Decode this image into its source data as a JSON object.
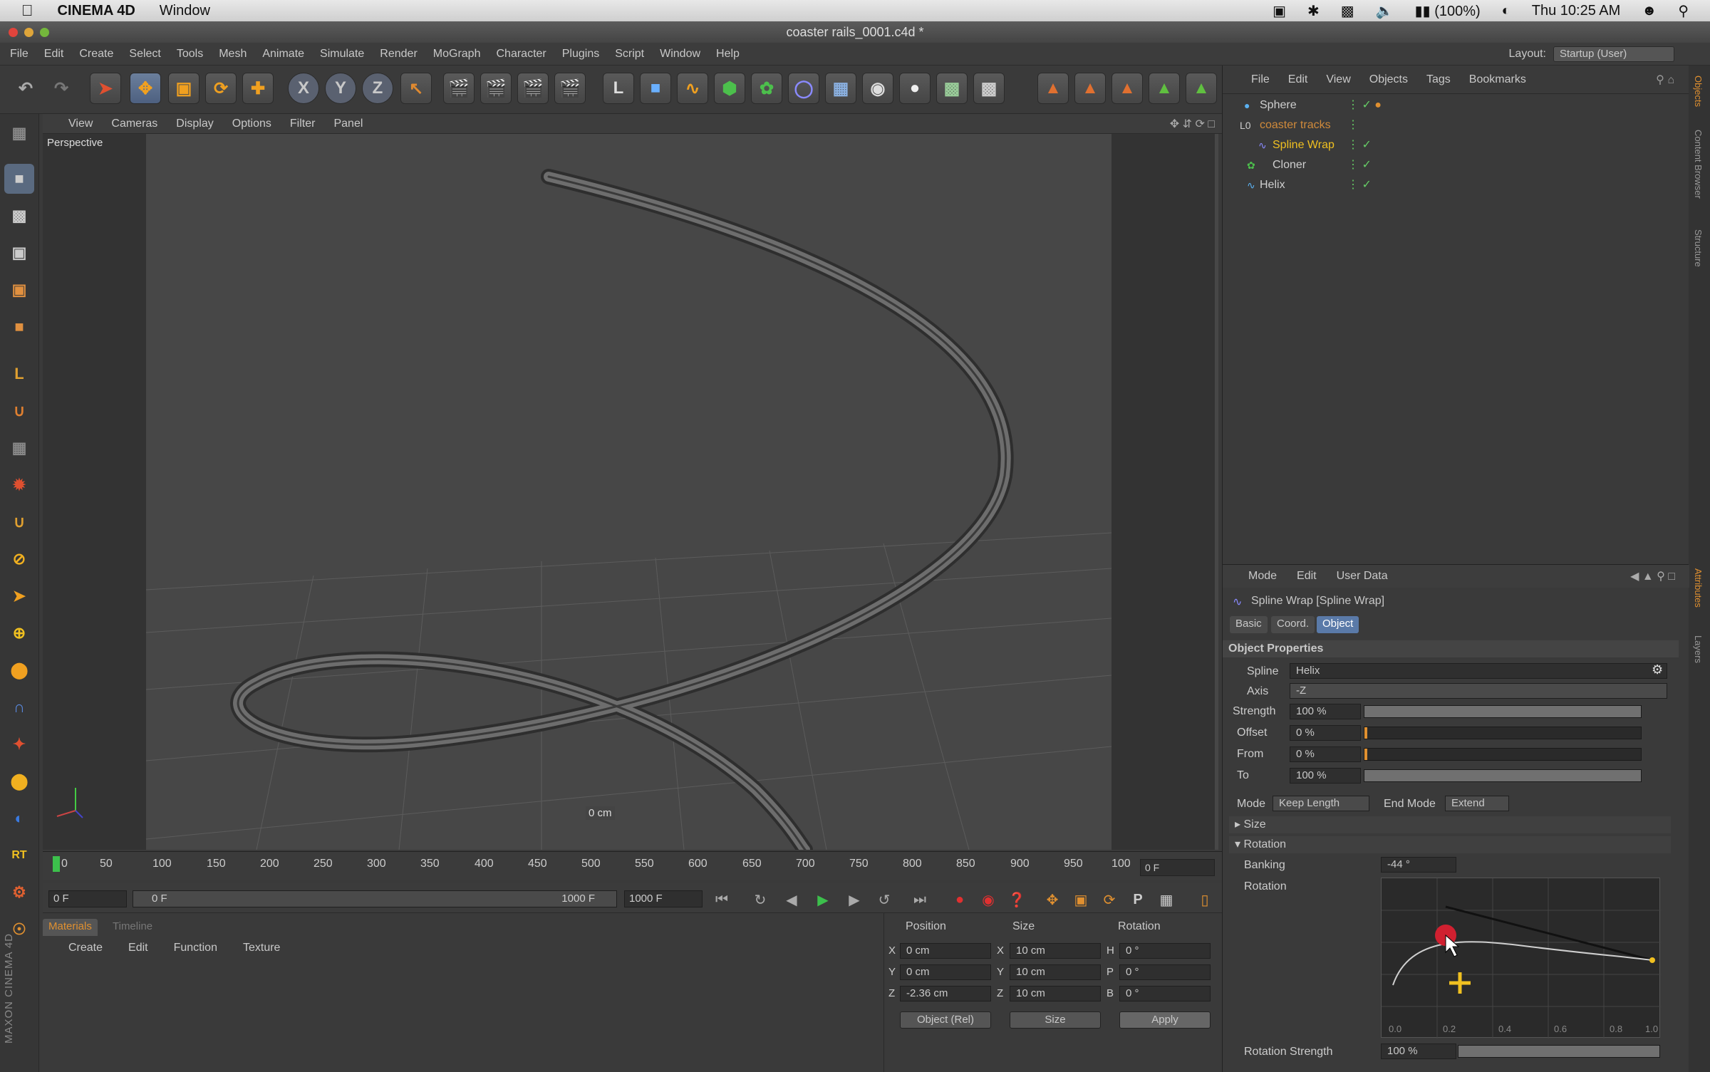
{
  "macbar": {
    "app": "CINEMA 4D",
    "menu": "Window",
    "battery": "(100%)",
    "clock": "Thu 10:25 AM"
  },
  "window": {
    "title": "coaster rails_0001.c4d *"
  },
  "menu": {
    "items": [
      "File",
      "Edit",
      "Create",
      "Select",
      "Tools",
      "Mesh",
      "Animate",
      "Simulate",
      "Render",
      "MoGraph",
      "Character",
      "Plugins",
      "Script",
      "Window",
      "Help"
    ],
    "layout_label": "Layout:",
    "layout_value": "Startup (User)"
  },
  "toolbar": {
    "axis_x": "X",
    "axis_y": "Y",
    "axis_z": "Z"
  },
  "viewport": {
    "menu": [
      "View",
      "Cameras",
      "Display",
      "Options",
      "Filter",
      "Panel"
    ],
    "label": "Perspective",
    "scale": "0 cm"
  },
  "timeline": {
    "ticks": [
      "0",
      "50",
      "100",
      "150",
      "200",
      "250",
      "300",
      "350",
      "400",
      "450",
      "500",
      "550",
      "600",
      "650",
      "700",
      "750",
      "800",
      "850",
      "900",
      "950",
      "100"
    ],
    "current_frame": "0 F",
    "start": "0 F",
    "range_start": "0 F",
    "range_end": "1000 F",
    "end": "1000 F"
  },
  "materials": {
    "tab_materials": "Materials",
    "tab_timeline": "Timeline",
    "menu": [
      "Create",
      "Edit",
      "Function",
      "Texture"
    ]
  },
  "coords": {
    "position": "Position",
    "size": "Size",
    "rotation": "Rotation",
    "rows": [
      {
        "axis": "X",
        "pos": "0 cm",
        "size_axis": "X",
        "size": "10 cm",
        "rot_axis": "H",
        "rot": "0 °"
      },
      {
        "axis": "Y",
        "pos": "0 cm",
        "size_axis": "Y",
        "size": "10 cm",
        "rot_axis": "P",
        "rot": "0 °"
      },
      {
        "axis": "Z",
        "pos": "-2.36 cm",
        "size_axis": "Z",
        "size": "10 cm",
        "rot_axis": "B",
        "rot": "0 °"
      }
    ],
    "mode": "Object (Rel)",
    "size_mode": "Size",
    "apply": "Apply"
  },
  "objects": {
    "menu": [
      "File",
      "Edit",
      "View",
      "Objects",
      "Tags",
      "Bookmarks"
    ],
    "items": [
      {
        "name": "Sphere",
        "color": "#cfcfcf"
      },
      {
        "name": "coaster tracks",
        "color": "#d08a3a"
      },
      {
        "name": "Spline Wrap",
        "color": "#f0c020"
      },
      {
        "name": "Cloner",
        "color": "#cfcfcf"
      },
      {
        "name": "Helix",
        "color": "#cfcfcf"
      }
    ]
  },
  "right_tabs": [
    "Objects",
    "Content Browser",
    "Structure",
    "Attributes",
    "Layers"
  ],
  "attributes": {
    "menu": [
      "Mode",
      "Edit",
      "User Data"
    ],
    "title": "Spline Wrap [Spline Wrap]",
    "tabs": [
      "Basic",
      "Coord.",
      "Object"
    ],
    "section": "Object Properties",
    "spline_label": "Spline",
    "spline_value": "Helix",
    "axis_label": "Axis",
    "axis_value": "-Z",
    "strength_label": "Strength",
    "strength_value": "100 %",
    "offset_label": "Offset",
    "offset_value": "0 %",
    "from_label": "From",
    "from_value": "0 %",
    "to_label": "To",
    "to_value": "100 %",
    "mode_label": "Mode",
    "mode_value": "Keep Length",
    "endmode_label": "End Mode",
    "endmode_value": "Extend",
    "size_section": "Size",
    "rotation_section": "Rotation",
    "banking_label": "Banking",
    "banking_value": "-44 °",
    "rotation_label": "Rotation",
    "graph_x": [
      "0.0",
      "0.2",
      "0.4",
      "0.6",
      "0.8",
      "1.0"
    ],
    "rotstrength_label": "Rotation Strength",
    "rotstrength_value": "100 %"
  }
}
